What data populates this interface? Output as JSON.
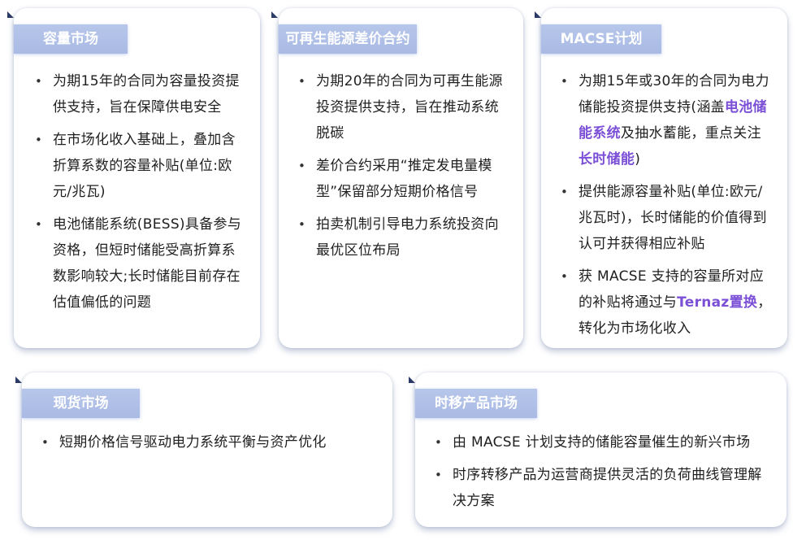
{
  "cards": [
    {
      "title": "容量市场",
      "items": [
        [
          "为期15年的合同为容量投资提供支持，旨在保障供电安全"
        ],
        [
          "在市场化收入基础上，叠加含折算系数的容量补贴(单位:欧元/兆瓦)"
        ],
        [
          "电池储能系统(BESS)具备参与资格，但短时储能受高折算系数影响较大;长时储能目前存在估值偏低的问题"
        ]
      ]
    },
    {
      "title": "可再生能源差价合约",
      "items": [
        [
          "为期20年的合同为可再生能源投资提供支持，旨在推动系统脱碳"
        ],
        [
          "差价合约采用“推定发电量模型”保留部分短期价格信号"
        ],
        [
          "拍卖机制引导电力系统投资向最优区位布局"
        ]
      ]
    },
    {
      "title": "MACSE计划",
      "items": [
        [
          "为期15年或30年的合同为电力储能投资提供支持(涵盖",
          "电池储能系统",
          "及抽水蓄能，重点关注",
          "长时储能",
          ")"
        ],
        [
          "提供能源容量补贴(单位:欧元/兆瓦时)，长时储能的价值得到认可并获得相应补贴"
        ],
        [
          "获 MACSE 支持的容量所对应的补贴将通过与",
          "Ternaz置换",
          "，转化为市场化收入"
        ]
      ]
    },
    {
      "title": "现货市场",
      "items": [
        [
          "短期价格信号驱动电力系统平衡与资产优化"
        ]
      ]
    },
    {
      "title": "时移产品市场",
      "items": [
        [
          "由 MACSE 计划支持的储能容量催生的新兴市场"
        ],
        [
          "时序转移产品为运营商提供灵活的负荷曲线管理解决方案"
        ]
      ]
    }
  ],
  "colors": {
    "tag_bg": "#aebfe6",
    "highlight": "#7b4fd6",
    "corner": "#2b3a67"
  }
}
